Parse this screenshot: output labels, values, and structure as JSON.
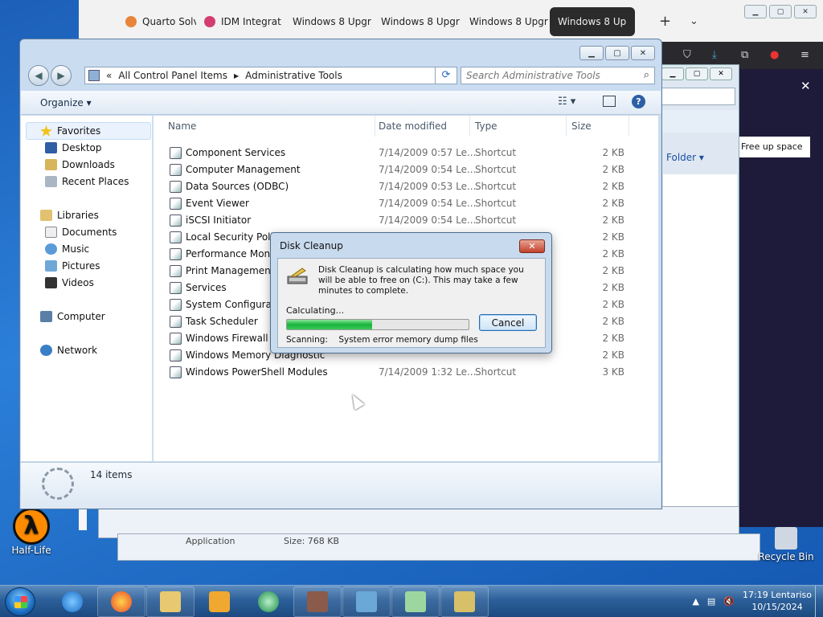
{
  "browser": {
    "tabs": [
      {
        "label": "Quarto Solve",
        "color": "#e8853a"
      },
      {
        "label": "IDM Integrat",
        "color": "#d33d6f"
      },
      {
        "label": "Windows 8 Upgr",
        "color": ""
      },
      {
        "label": "Windows 8 Upgr",
        "color": ""
      },
      {
        "label": "Windows 8 Upgr",
        "color": ""
      },
      {
        "label": "Windows 8 Up",
        "color": ""
      }
    ],
    "new_tab_label": "+",
    "free_up_space_label": "Free up space"
  },
  "bg_explorer": {
    "folder_label": "Folder ▾",
    "bottom_type": "Application",
    "bottom_size": "Size: 768 KB"
  },
  "desktop": {
    "halflife_label": "Half-Life",
    "halflife_glyph": "λ",
    "recycle_label": "Recycle Bin"
  },
  "explorer": {
    "address": {
      "chevron": "«",
      "crumbs": [
        "All Control Panel Items",
        "Administrative Tools"
      ]
    },
    "search_placeholder": "Search Administrative Tools",
    "organize_label": "Organize ▾",
    "nav": {
      "favorites": "Favorites",
      "desktop": "Desktop",
      "downloads": "Downloads",
      "recent": "Recent Places",
      "libraries": "Libraries",
      "documents": "Documents",
      "music": "Music",
      "pictures": "Pictures",
      "videos": "Videos",
      "computer": "Computer",
      "network": "Network"
    },
    "columns": {
      "name": "Name",
      "date": "Date modified",
      "type": "Type",
      "size": "Size"
    },
    "rows": [
      {
        "name": "Component Services",
        "date": "7/14/2009 0:57 Le...",
        "type": "Shortcut",
        "size": "2 KB"
      },
      {
        "name": "Computer Management",
        "date": "7/14/2009 0:54 Le...",
        "type": "Shortcut",
        "size": "2 KB"
      },
      {
        "name": "Data Sources (ODBC)",
        "date": "7/14/2009 0:53 Le...",
        "type": "Shortcut",
        "size": "2 KB"
      },
      {
        "name": "Event Viewer",
        "date": "7/14/2009 0:54 Le...",
        "type": "Shortcut",
        "size": "2 KB"
      },
      {
        "name": "iSCSI Initiator",
        "date": "7/14/2009 0:54 Le...",
        "type": "Shortcut",
        "size": "2 KB"
      },
      {
        "name": "Local Security Policy",
        "date": "",
        "type": "",
        "size": "2 KB"
      },
      {
        "name": "Performance Monito",
        "date": "",
        "type": "",
        "size": "2 KB"
      },
      {
        "name": "Print Management",
        "date": "",
        "type": "",
        "size": "2 KB"
      },
      {
        "name": "Services",
        "date": "",
        "type": "",
        "size": "2 KB"
      },
      {
        "name": "System Configuratio",
        "date": "",
        "type": "",
        "size": "2 KB"
      },
      {
        "name": "Task Scheduler",
        "date": "",
        "type": "",
        "size": "2 KB"
      },
      {
        "name": "Windows Firewall wi",
        "date": "",
        "type": "",
        "size": "2 KB"
      },
      {
        "name": "Windows Memory Diagnostic",
        "date": "",
        "type": "",
        "size": "2 KB"
      },
      {
        "name": "Windows PowerShell Modules",
        "date": "7/14/2009 1:32 Le...",
        "type": "Shortcut",
        "size": "3 KB"
      }
    ],
    "item_count": "14 items"
  },
  "dialog": {
    "title": "Disk Cleanup",
    "close_glyph": "✕",
    "message": "Disk Cleanup is calculating how much space you will be able to free on  (C:). This may take a few minutes to complete.",
    "calculating": "Calculating...",
    "progress": 0.47,
    "cancel_label": "Cancel",
    "scanning_label": "Scanning:",
    "scanning_value": "System error memory dump files"
  },
  "taskbar": {
    "time": "17:19 Lentariso",
    "date": "10/15/2024"
  },
  "colors": {
    "accent": "#2d6bb0",
    "progress_green": "#18b43a",
    "close_red": "#c2412c"
  }
}
